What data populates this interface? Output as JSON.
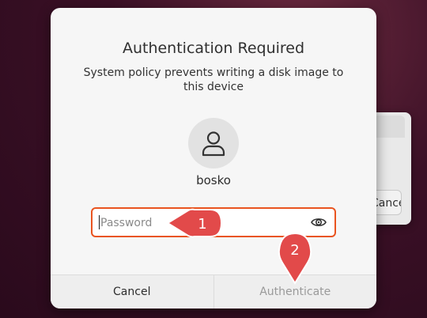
{
  "background_window": {
    "cancel_label": "Cancel"
  },
  "dialog": {
    "title": "Authentication Required",
    "message": "System policy prevents writing a disk image to this device",
    "username": "bosko",
    "password": {
      "placeholder": "Password",
      "value": ""
    },
    "buttons": {
      "cancel": "Cancel",
      "authenticate": "Authenticate"
    }
  },
  "annotations": {
    "step1": "1",
    "step2": "2"
  },
  "colors": {
    "accent": "#e95420",
    "callout": "#e24a4a"
  }
}
